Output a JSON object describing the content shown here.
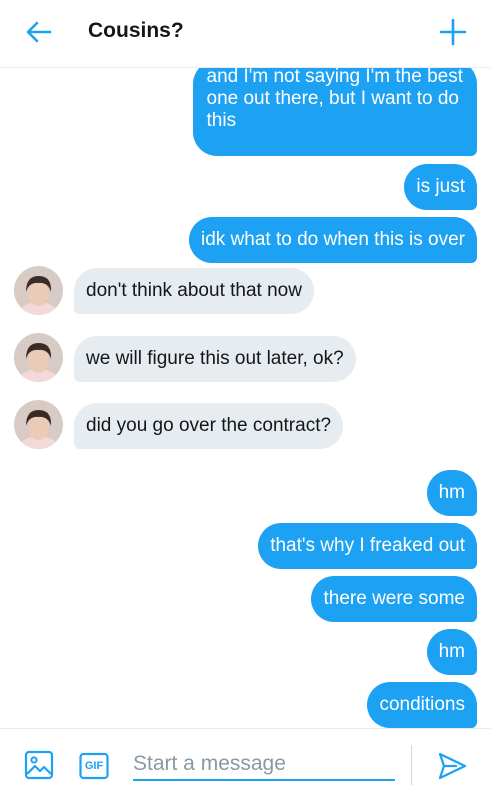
{
  "header": {
    "title": "Cousins?",
    "back_icon": "arrow-left-icon",
    "new_icon": "plus-icon",
    "accent": "#1da1f2"
  },
  "messages": [
    {
      "from": "me",
      "lines": [
        "and I'm not saying I'm the best",
        "one out there, but I want to do",
        "this"
      ]
    },
    {
      "from": "me",
      "text": "is just"
    },
    {
      "from": "me",
      "text": "idk what to do when this is over"
    },
    {
      "from": "them",
      "text": "don't think about that now"
    },
    {
      "from": "them",
      "text": "we will figure this out later, ok?"
    },
    {
      "from": "them",
      "text": "did you go over the contract?"
    },
    {
      "from": "me",
      "text": "hm"
    },
    {
      "from": "me",
      "text": "that's why I freaked out"
    },
    {
      "from": "me",
      "text": "there were some"
    },
    {
      "from": "me",
      "text": "hm"
    },
    {
      "from": "me",
      "text": "conditions"
    }
  ],
  "composer": {
    "placeholder": "Start a message",
    "media_icon": "image-icon",
    "gif_label": "GIF",
    "send_icon": "send-icon"
  },
  "colors": {
    "outgoing_bubble": "#1da1f2",
    "incoming_bubble": "#e6ecf0"
  }
}
